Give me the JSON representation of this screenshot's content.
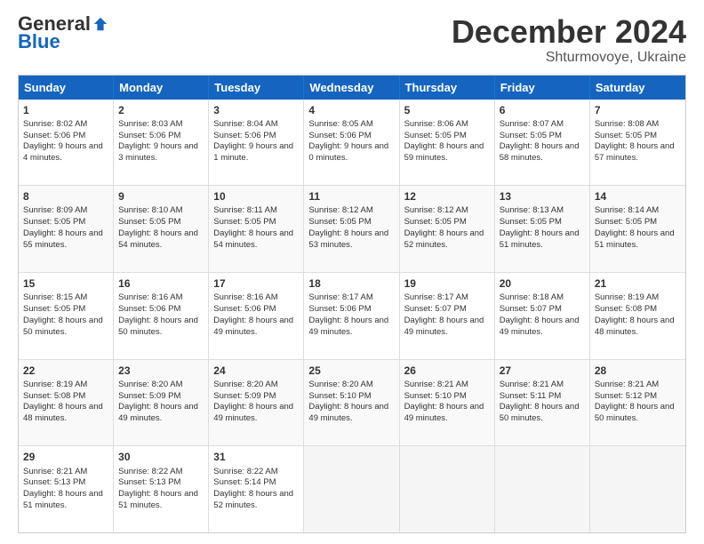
{
  "logo": {
    "general": "General",
    "blue": "Blue"
  },
  "header": {
    "month": "December 2024",
    "location": "Shturmovoye, Ukraine"
  },
  "weekdays": [
    "Sunday",
    "Monday",
    "Tuesday",
    "Wednesday",
    "Thursday",
    "Friday",
    "Saturday"
  ],
  "weeks": [
    [
      {
        "day": "1",
        "sunrise": "Sunrise: 8:02 AM",
        "sunset": "Sunset: 5:06 PM",
        "daylight": "Daylight: 9 hours and 4 minutes."
      },
      {
        "day": "2",
        "sunrise": "Sunrise: 8:03 AM",
        "sunset": "Sunset: 5:06 PM",
        "daylight": "Daylight: 9 hours and 3 minutes."
      },
      {
        "day": "3",
        "sunrise": "Sunrise: 8:04 AM",
        "sunset": "Sunset: 5:06 PM",
        "daylight": "Daylight: 9 hours and 1 minute."
      },
      {
        "day": "4",
        "sunrise": "Sunrise: 8:05 AM",
        "sunset": "Sunset: 5:06 PM",
        "daylight": "Daylight: 9 hours and 0 minutes."
      },
      {
        "day": "5",
        "sunrise": "Sunrise: 8:06 AM",
        "sunset": "Sunset: 5:05 PM",
        "daylight": "Daylight: 8 hours and 59 minutes."
      },
      {
        "day": "6",
        "sunrise": "Sunrise: 8:07 AM",
        "sunset": "Sunset: 5:05 PM",
        "daylight": "Daylight: 8 hours and 58 minutes."
      },
      {
        "day": "7",
        "sunrise": "Sunrise: 8:08 AM",
        "sunset": "Sunset: 5:05 PM",
        "daylight": "Daylight: 8 hours and 57 minutes."
      }
    ],
    [
      {
        "day": "8",
        "sunrise": "Sunrise: 8:09 AM",
        "sunset": "Sunset: 5:05 PM",
        "daylight": "Daylight: 8 hours and 55 minutes."
      },
      {
        "day": "9",
        "sunrise": "Sunrise: 8:10 AM",
        "sunset": "Sunset: 5:05 PM",
        "daylight": "Daylight: 8 hours and 54 minutes."
      },
      {
        "day": "10",
        "sunrise": "Sunrise: 8:11 AM",
        "sunset": "Sunset: 5:05 PM",
        "daylight": "Daylight: 8 hours and 54 minutes."
      },
      {
        "day": "11",
        "sunrise": "Sunrise: 8:12 AM",
        "sunset": "Sunset: 5:05 PM",
        "daylight": "Daylight: 8 hours and 53 minutes."
      },
      {
        "day": "12",
        "sunrise": "Sunrise: 8:12 AM",
        "sunset": "Sunset: 5:05 PM",
        "daylight": "Daylight: 8 hours and 52 minutes."
      },
      {
        "day": "13",
        "sunrise": "Sunrise: 8:13 AM",
        "sunset": "Sunset: 5:05 PM",
        "daylight": "Daylight: 8 hours and 51 minutes."
      },
      {
        "day": "14",
        "sunrise": "Sunrise: 8:14 AM",
        "sunset": "Sunset: 5:05 PM",
        "daylight": "Daylight: 8 hours and 51 minutes."
      }
    ],
    [
      {
        "day": "15",
        "sunrise": "Sunrise: 8:15 AM",
        "sunset": "Sunset: 5:05 PM",
        "daylight": "Daylight: 8 hours and 50 minutes."
      },
      {
        "day": "16",
        "sunrise": "Sunrise: 8:16 AM",
        "sunset": "Sunset: 5:06 PM",
        "daylight": "Daylight: 8 hours and 50 minutes."
      },
      {
        "day": "17",
        "sunrise": "Sunrise: 8:16 AM",
        "sunset": "Sunset: 5:06 PM",
        "daylight": "Daylight: 8 hours and 49 minutes."
      },
      {
        "day": "18",
        "sunrise": "Sunrise: 8:17 AM",
        "sunset": "Sunset: 5:06 PM",
        "daylight": "Daylight: 8 hours and 49 minutes."
      },
      {
        "day": "19",
        "sunrise": "Sunrise: 8:17 AM",
        "sunset": "Sunset: 5:07 PM",
        "daylight": "Daylight: 8 hours and 49 minutes."
      },
      {
        "day": "20",
        "sunrise": "Sunrise: 8:18 AM",
        "sunset": "Sunset: 5:07 PM",
        "daylight": "Daylight: 8 hours and 49 minutes."
      },
      {
        "day": "21",
        "sunrise": "Sunrise: 8:19 AM",
        "sunset": "Sunset: 5:08 PM",
        "daylight": "Daylight: 8 hours and 48 minutes."
      }
    ],
    [
      {
        "day": "22",
        "sunrise": "Sunrise: 8:19 AM",
        "sunset": "Sunset: 5:08 PM",
        "daylight": "Daylight: 8 hours and 48 minutes."
      },
      {
        "day": "23",
        "sunrise": "Sunrise: 8:20 AM",
        "sunset": "Sunset: 5:09 PM",
        "daylight": "Daylight: 8 hours and 49 minutes."
      },
      {
        "day": "24",
        "sunrise": "Sunrise: 8:20 AM",
        "sunset": "Sunset: 5:09 PM",
        "daylight": "Daylight: 8 hours and 49 minutes."
      },
      {
        "day": "25",
        "sunrise": "Sunrise: 8:20 AM",
        "sunset": "Sunset: 5:10 PM",
        "daylight": "Daylight: 8 hours and 49 minutes."
      },
      {
        "day": "26",
        "sunrise": "Sunrise: 8:21 AM",
        "sunset": "Sunset: 5:10 PM",
        "daylight": "Daylight: 8 hours and 49 minutes."
      },
      {
        "day": "27",
        "sunrise": "Sunrise: 8:21 AM",
        "sunset": "Sunset: 5:11 PM",
        "daylight": "Daylight: 8 hours and 50 minutes."
      },
      {
        "day": "28",
        "sunrise": "Sunrise: 8:21 AM",
        "sunset": "Sunset: 5:12 PM",
        "daylight": "Daylight: 8 hours and 50 minutes."
      }
    ],
    [
      {
        "day": "29",
        "sunrise": "Sunrise: 8:21 AM",
        "sunset": "Sunset: 5:13 PM",
        "daylight": "Daylight: 8 hours and 51 minutes."
      },
      {
        "day": "30",
        "sunrise": "Sunrise: 8:22 AM",
        "sunset": "Sunset: 5:13 PM",
        "daylight": "Daylight: 8 hours and 51 minutes."
      },
      {
        "day": "31",
        "sunrise": "Sunrise: 8:22 AM",
        "sunset": "Sunset: 5:14 PM",
        "daylight": "Daylight: 8 hours and 52 minutes."
      },
      null,
      null,
      null,
      null
    ]
  ]
}
